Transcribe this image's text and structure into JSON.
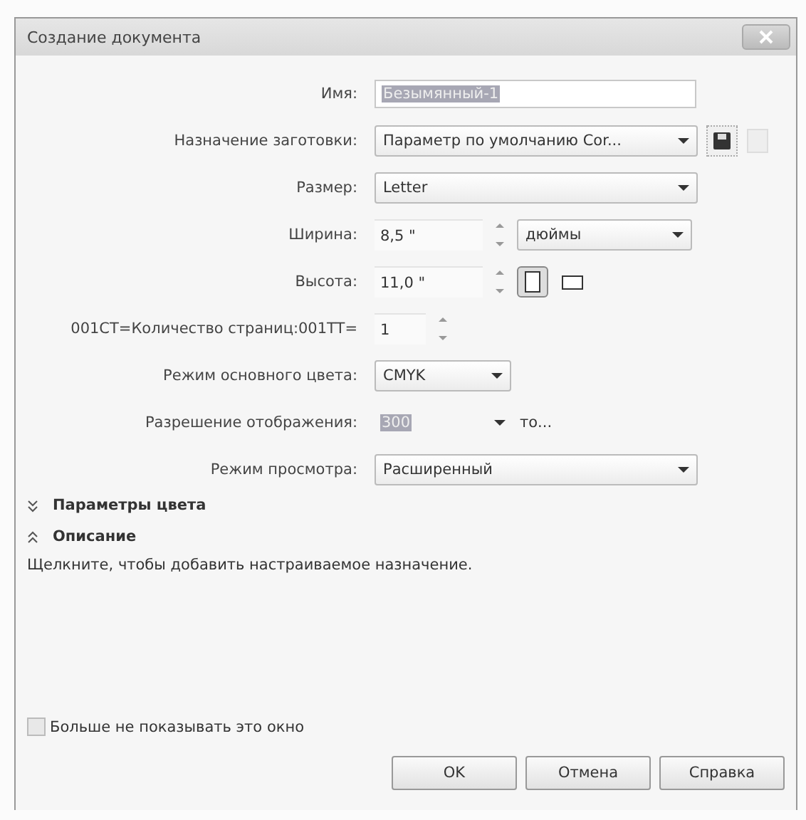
{
  "window": {
    "title": "Создание документа"
  },
  "fields": [
    {
      "kind": "text",
      "label": "Имя:",
      "value": "Безымянный-1",
      "selected": true
    },
    {
      "kind": "preset",
      "label": "Назначение заготовки:",
      "value": "Параметр по умолчанию Cor..."
    },
    {
      "kind": "dropdown",
      "label": "Размер:",
      "value": "Letter"
    },
    {
      "kind": "dimension",
      "label": "Ширина:",
      "value": "8,5 \"",
      "unit": "дюймы"
    },
    {
      "kind": "orientation",
      "label": "Высота:",
      "value": "11,0 \"",
      "portrait": true
    },
    {
      "kind": "spin",
      "label": "001CT=Количество страниц:001TT=",
      "value": "1"
    },
    {
      "kind": "short-dropdown",
      "label": "Режим основного цвета:",
      "value": "CMYK"
    },
    {
      "kind": "resolution",
      "label": "Разрешение отображения:",
      "value": "300",
      "selected": true,
      "suffix": "то..."
    },
    {
      "kind": "dropdown",
      "label": "Режим просмотра:",
      "value": "Расширенный"
    }
  ],
  "sections": [
    {
      "label": "Параметры цвета",
      "expanded": false
    },
    {
      "label": "Описание",
      "expanded": true,
      "text": "Щелкните, чтобы добавить настраиваемое назначение."
    }
  ],
  "dont_show": {
    "label": "Больше не показывать это окно",
    "checked": false
  },
  "buttons": [
    {
      "label": "OK"
    },
    {
      "label": "Отмена"
    },
    {
      "label": "Справка"
    }
  ]
}
